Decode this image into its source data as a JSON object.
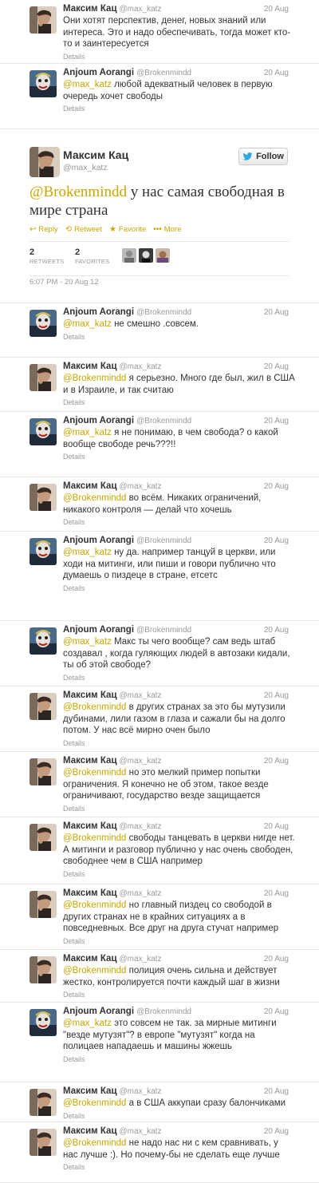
{
  "tweets_before": [
    {
      "name": "Максим Кац",
      "handle": "@max_katz",
      "date": "20 Aug",
      "avatar": "katz",
      "parts": [
        {
          "t": "Они хотят перспектив, денег, новых знаний или интереса. Это и надо обеспечивать, тогда может кто-то и заинтересуется"
        }
      ],
      "details": "Details"
    },
    {
      "name": "Anjoum Aorangi",
      "handle": "@Brokenmindd",
      "date": "20 Aug",
      "avatar": "anjoum",
      "parts": [
        {
          "m": "@max_katz"
        },
        {
          "t": " любой адекватный человек в первую очередь хочет свободы"
        }
      ],
      "details": "Details"
    }
  ],
  "focus": {
    "name": "Максим Кац",
    "handle": "@max_katz",
    "follow_label": "Follow",
    "mention": "@Brokenmindd",
    "text": " у нас самая свободная в мире страна",
    "actions": [
      {
        "icon": "reply-icon",
        "glyph": "↩",
        "label": "Reply"
      },
      {
        "icon": "retweet-icon",
        "glyph": "⟲",
        "label": "Retweet"
      },
      {
        "icon": "star-icon",
        "glyph": "★",
        "label": "Favorite"
      },
      {
        "icon": "more-icon",
        "glyph": "•••",
        "label": "More"
      }
    ],
    "retweets_count": "2",
    "retweets_label": "RETWEETS",
    "favorites_count": "2",
    "favorites_label": "FAVORITES",
    "timestamp": "6:07 PM - 20 Aug 12"
  },
  "replies": [
    {
      "name": "Anjoum Aorangi",
      "handle": "@Brokenmindd",
      "date": "20 Aug",
      "avatar": "anjoum",
      "parts": [
        {
          "m": "@max_katz"
        },
        {
          "t": " не смешно .совсем."
        }
      ],
      "details": "Details"
    },
    {
      "name": "Максим Кац",
      "handle": "@max_katz",
      "date": "20 Aug",
      "avatar": "katz",
      "parts": [
        {
          "m": "@Brokenmindd"
        },
        {
          "t": " я серьезно. Много где был, жил в США и в Израиле,  и так считаю"
        }
      ],
      "details": "Details"
    },
    {
      "name": "Anjoum Aorangi",
      "handle": "@Brokenmindd",
      "date": "20 Aug",
      "avatar": "anjoum",
      "parts": [
        {
          "m": "@max_katz"
        },
        {
          "t": " я не понимаю, в чем свобода? о какой вообще свободе речь???!!"
        }
      ],
      "details": "Details"
    },
    {
      "name": "Максим Кац",
      "handle": "@max_katz",
      "date": "20 Aug",
      "avatar": "katz",
      "parts": [
        {
          "m": "@Brokenmindd"
        },
        {
          "t": " во всём. Никаких ограничений, никакого контроля — делай что хочешь"
        }
      ],
      "details": "Details"
    },
    {
      "name": "Anjoum Aorangi",
      "handle": "@Brokenmindd",
      "date": "20 Aug",
      "avatar": "anjoum",
      "parts": [
        {
          "m": "@max_katz"
        },
        {
          "t": " ну да. например танцуй в церкви, или ходи на митинги, или пиши и говори публично что думаешь о пиздеце в стране, етсетс"
        }
      ],
      "details": "Details"
    },
    {
      "name": "Anjoum Aorangi",
      "handle": "@Brokenmindd",
      "date": "20 Aug",
      "avatar": "anjoum",
      "parts": [
        {
          "m": "@max_katz"
        },
        {
          "t": " Макс ты чего вообще? сам ведь штаб создавал , когда гуляющих людей в автозаки кидали, ты об этой свободе?"
        }
      ],
      "details": "Details"
    },
    {
      "name": "Максим Кац",
      "handle": "@max_katz",
      "date": "20 Aug",
      "avatar": "katz",
      "parts": [
        {
          "m": "@Brokenmindd"
        },
        {
          "t": " в других странах за это бы мутузили дубинами, лили газом в глаза и сажали бы на долго потом. У нас всё мирно очен было"
        }
      ],
      "details": "Details"
    },
    {
      "name": "Максим Кац",
      "handle": "@max_katz",
      "date": "20 Aug",
      "avatar": "katz",
      "parts": [
        {
          "m": "@Brokenmindd"
        },
        {
          "t": " но это мелкий пример попытки ограничения. Я конечно не об этом, такое везде ограничивают, государство везде защищается"
        }
      ],
      "details": "Details"
    },
    {
      "name": "Максим Кац",
      "handle": "@max_katz",
      "date": "20 Aug",
      "avatar": "katz",
      "parts": [
        {
          "m": "@Brokenmindd"
        },
        {
          "t": " свободы танцевать в церкви нигде нет. А митинги и разговор публично у нас очень свободен, свободнее чем в США например"
        }
      ],
      "details": "Details"
    },
    {
      "name": "Максим Кац",
      "handle": "@max_katz",
      "date": "20 Aug",
      "avatar": "katz",
      "parts": [
        {
          "m": "@Brokenmindd"
        },
        {
          "t": " но главный пиздец со свободой в других странах не в крайних ситуациях а в повседневных. Все друг на друга стучат например"
        }
      ],
      "details": "Details"
    },
    {
      "name": "Максим Кац",
      "handle": "@max_katz",
      "date": "20 Aug",
      "avatar": "katz",
      "parts": [
        {
          "m": "@Brokenmindd"
        },
        {
          "t": " полиция очень сильна и действует жестко, контролируется почти каждый шаг в жизни"
        }
      ],
      "details": "Details"
    },
    {
      "name": "Anjoum Aorangi",
      "handle": "@Brokenmindd",
      "date": "20 Aug",
      "avatar": "anjoum",
      "parts": [
        {
          "m": "@max_katz"
        },
        {
          "t": " это совсем не так. за мирные митинги \"везде мутузят\"? в европе  \"мутузят\"  когда на полицаев нападаешь и машины жжешь"
        }
      ],
      "details": "Details"
    },
    {
      "name": "Максим Кац",
      "handle": "@max_katz",
      "date": "20 Aug",
      "avatar": "katz",
      "parts": [
        {
          "m": "@Brokenmindd"
        },
        {
          "t": " а в США аккупаи сразу балончиками"
        }
      ],
      "details": "Details"
    },
    {
      "name": "Максим Кац",
      "handle": "@max_katz",
      "date": "20 Aug",
      "avatar": "katz",
      "parts": [
        {
          "m": "@Brokenmindd"
        },
        {
          "t": " не надо нас ни с кем сравнивать, у нас лучше :). Но почему-бы не сделать еще лучше"
        }
      ],
      "details": "Details"
    }
  ],
  "colors": {
    "mention": "#c9a600",
    "muted": "#999999",
    "text": "#333333",
    "twitter_blue": "#2aa9e0"
  }
}
